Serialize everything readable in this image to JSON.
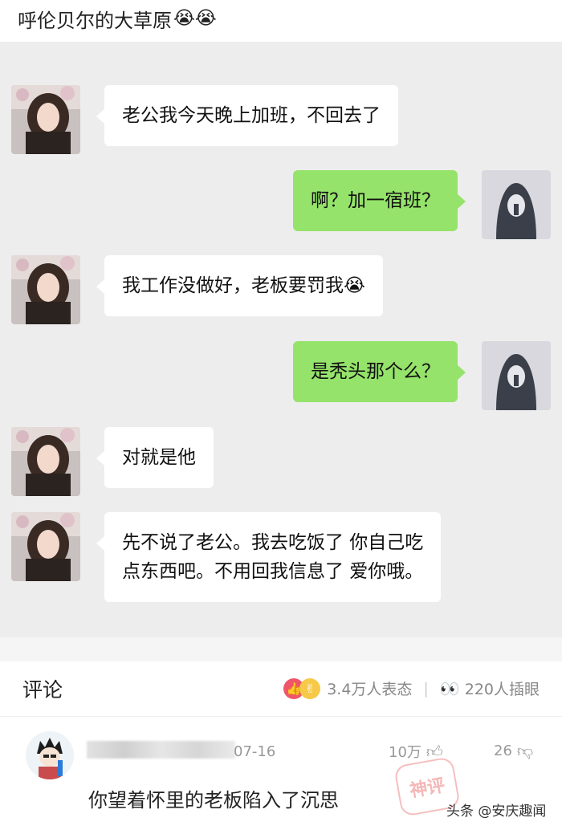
{
  "post": {
    "title": "呼伦贝尔的大草原",
    "title_emoji": "😭😭"
  },
  "chat": {
    "messages": [
      {
        "side": "left",
        "text": "老公我今天晚上加班，不回去了"
      },
      {
        "side": "right",
        "text": "啊？加一宿班？"
      },
      {
        "side": "left",
        "text": "我工作没做好，老板要罚我😭"
      },
      {
        "side": "right",
        "text": "是秃头那个么？"
      },
      {
        "side": "left",
        "text": "对就是他"
      },
      {
        "side": "left",
        "text": "先不说了老公。我去吃饭了 你自己吃\n点东西吧。不用回我信息了 爱你哦。"
      }
    ]
  },
  "comments_header": {
    "title": "评论",
    "reactions_count": "3.4万人表态",
    "peek_count": "220人插眼",
    "separator": "|"
  },
  "comment": {
    "date": "07-16",
    "likes": "10万",
    "replies": "26",
    "text": "你望着怀里的老板陷入了沉思"
  },
  "stamp_text": "神评",
  "watermark": "头条 @安庆趣闻",
  "colors": {
    "chat_bg": "#ededed",
    "bubble_green": "#95e36a",
    "bubble_white": "#ffffff"
  }
}
